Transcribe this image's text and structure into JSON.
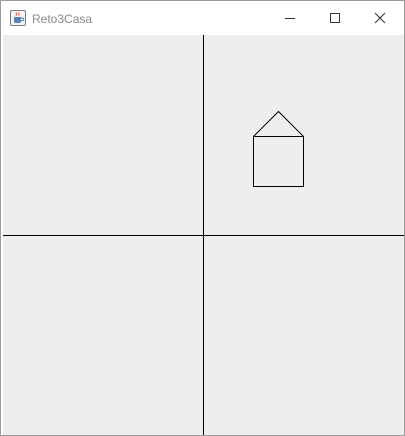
{
  "window": {
    "title": "Reto3Casa",
    "app_icon": "java-coffee-cup-icon",
    "controls": {
      "minimize_icon": "minimize-icon",
      "maximize_icon": "maximize-icon",
      "close_icon": "close-icon"
    }
  },
  "canvas": {
    "background_color": "#eeeeee",
    "line_color": "#000000",
    "shapes": [
      "vertical-axis-line",
      "horizontal-axis-line",
      "house-roof",
      "house-body"
    ]
  }
}
